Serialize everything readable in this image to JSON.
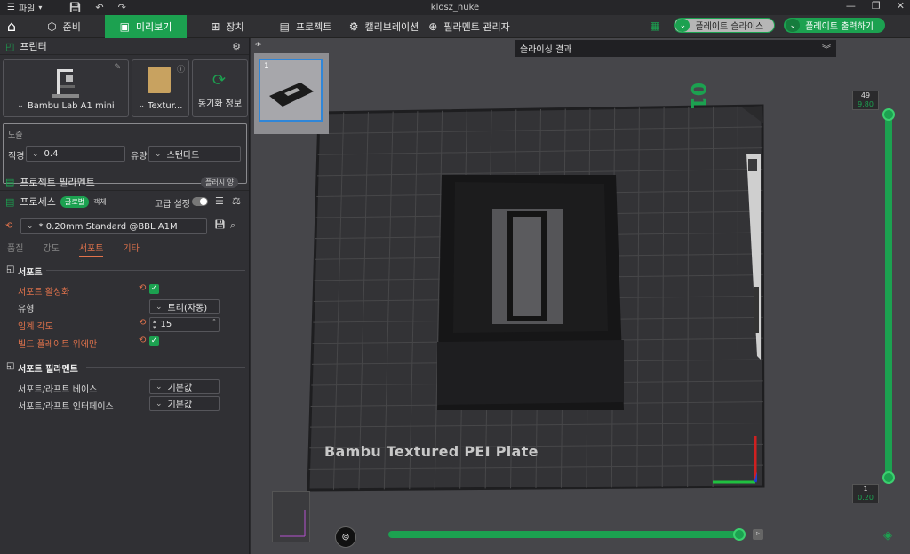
{
  "window": {
    "title": "klosz_nuke",
    "file_menu": "파일"
  },
  "nav": {
    "tabs": [
      {
        "label": "준비",
        "icon": "cube-icon"
      },
      {
        "label": "미리보기",
        "icon": "preview-icon"
      },
      {
        "label": "장치",
        "icon": "device-icon"
      },
      {
        "label": "프로젝트",
        "icon": "project-icon"
      },
      {
        "label": "캘리브레이션",
        "icon": "calibration-icon"
      },
      {
        "label": "필라멘트 관리자",
        "icon": "filament-manager-icon"
      }
    ],
    "slice_plate": "플레이트 슬라이스",
    "print_plate": "플레이트 출력하기"
  },
  "sidebar": {
    "printer_title": "프린터",
    "printer_name": "Bambu Lab A1 mini",
    "plate_name": "Textur...",
    "sync_label": "동기화 정보",
    "nozzle_section": "노즐",
    "diameter_label": "직경",
    "diameter_value": "0.4",
    "flow_label": "유량",
    "flow_value": "스탠다드",
    "filament_title": "프로젝트 필라멘트",
    "filament_badge": "플러시 양",
    "process_title": "프로세스",
    "global_badge": "글로벌",
    "object_badge": "객체",
    "advanced_label": "고급 설정",
    "preset": "* 0.20mm Standard @BBL A1M",
    "subtabs": [
      "품질",
      "강도",
      "서포트",
      "기타"
    ],
    "support_section": "서포트",
    "enable_support": "서포트 활성화",
    "type_label": "유형",
    "type_value": "트리(자동)",
    "threshold_label": "임계 각도",
    "threshold_value": "15",
    "degree_unit": "°",
    "buildplate_only": "빌드 플레이트 위에만",
    "support_filament_section": "서포트 필라멘트",
    "raft_base_label": "서포트/라프트 베이스",
    "raft_base_value": "기본값",
    "raft_interface_label": "서포트/라프트 인터페이스",
    "raft_interface_value": "기본값"
  },
  "viewport": {
    "slice_result": "슬라이싱 결과",
    "plate_number": "1",
    "bed_label": "Bambu Textured PEI Plate",
    "bed_corner_number": "01",
    "layer_top": "49",
    "layer_top_height": "9.80",
    "layer_bottom": "1",
    "layer_bottom_height": "0.20",
    "layer_progress": 1.0,
    "gcode_progress": 1.0
  },
  "colors": {
    "accent": "#1ca150",
    "warn": "#e2734c",
    "bg": "#303034",
    "viewport": "#46464a"
  }
}
